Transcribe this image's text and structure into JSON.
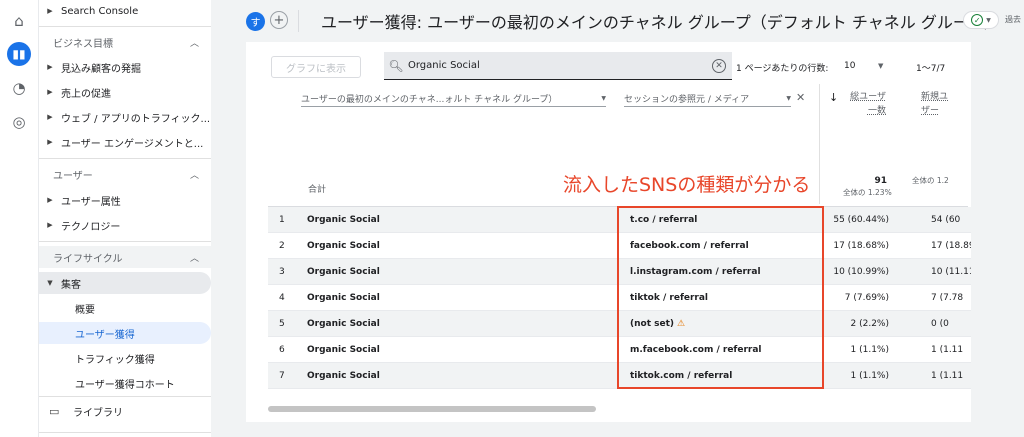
{
  "rail": {
    "icons": [
      "home-icon",
      "reports-icon",
      "explore-icon",
      "advertising-icon"
    ]
  },
  "sidebar": {
    "search_console": "Search Console",
    "sections": {
      "business": "ビジネス目標",
      "user": "ユーザー",
      "lifecycle": "ライフサイクル"
    },
    "business_items": [
      "見込み顧客の発掘",
      "売上の促進",
      "ウェブ / アプリのトラフィック...",
      "ユーザー エンゲージメントと..."
    ],
    "user_items": [
      "ユーザー属性",
      "テクノロジー"
    ],
    "acquisition": "集客",
    "acq_items": [
      "概要",
      "ユーザー獲得",
      "トラフィック獲得",
      "ユーザー獲得コホート"
    ],
    "library": "ライブラリ"
  },
  "header": {
    "avatar_letter": "す",
    "title": "ユーザー獲得: ユーザーの最初のメインのチャネル グループ（デフォルト チャネル グループ）",
    "past_label": "過去"
  },
  "toolbar": {
    "graph_button": "グラフに表示",
    "search_value": "Organic Social",
    "rows_label": "1 ページあたりの行数:",
    "rows_value": "10",
    "range": "1〜7/7"
  },
  "table": {
    "dim1": "ユーザーの最初のメインのチャネ...ォルト チャネル グループ）",
    "dim2": "セッションの参照元 / メディア",
    "metric1": [
      "総ユーザ",
      "一数"
    ],
    "metric2": [
      "新規ユ",
      "ザー"
    ],
    "total_label": "合計",
    "total1_value": "91",
    "total1_sub": "全体の 1.23%",
    "total2_value": "",
    "total2_sub": "全体の 1.2",
    "rows": [
      {
        "n": "1",
        "channel": "Organic Social",
        "source": "t.co / referral",
        "m1": "55 (60.44%)",
        "m2": "54 (60"
      },
      {
        "n": "2",
        "channel": "Organic Social",
        "source": "facebook.com / referral",
        "m1": "17 (18.68%)",
        "m2": "17 (18.89"
      },
      {
        "n": "3",
        "channel": "Organic Social",
        "source": "l.instagram.com / referral",
        "m1": "10 (10.99%)",
        "m2": "10 (11.11"
      },
      {
        "n": "4",
        "channel": "Organic Social",
        "source": "tiktok / referral",
        "m1": "7 (7.69%)",
        "m2": "7 (7.78"
      },
      {
        "n": "5",
        "channel": "Organic Social",
        "source": "(not set)",
        "m1": "2 (2.2%)",
        "m2": "0 (0"
      },
      {
        "n": "6",
        "channel": "Organic Social",
        "source": "m.facebook.com / referral",
        "m1": "1 (1.1%)",
        "m2": "1 (1.11"
      },
      {
        "n": "7",
        "channel": "Organic Social",
        "source": "tiktok.com / referral",
        "m1": "1 (1.1%)",
        "m2": "1 (1.11"
      }
    ]
  },
  "annotation": "流入したSNSの種類が分かる",
  "colors": {
    "accent": "#1a73e8",
    "annotation": "#e8462a",
    "selected_bg": "#e8f0fe"
  }
}
